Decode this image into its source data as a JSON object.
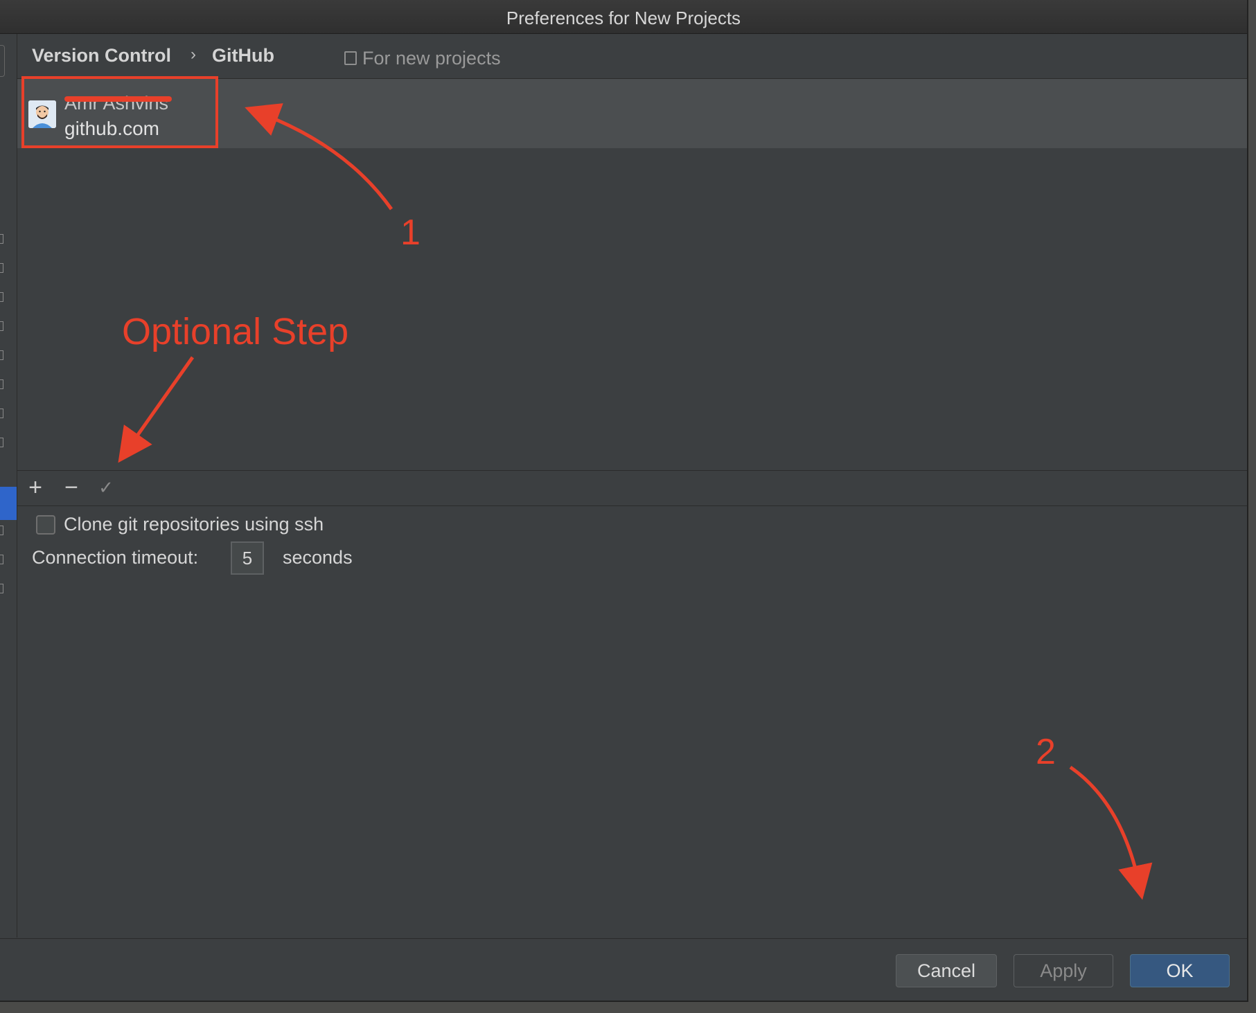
{
  "window": {
    "title": "Preferences for New Projects"
  },
  "header": {
    "breadcrumb": [
      "Version Control",
      "GitHub"
    ],
    "scope_label": "For new projects"
  },
  "accounts": [
    {
      "name": "Amr Ashvins",
      "host": "github.com"
    }
  ],
  "toolbar": {
    "add": "+",
    "remove": "−",
    "default": "✓"
  },
  "options": {
    "clone_ssh_label": "Clone git repositories using ssh",
    "clone_ssh_checked": false,
    "timeout_label": "Connection timeout:",
    "timeout_value": "5",
    "timeout_unit": "seconds"
  },
  "footer": {
    "cancel": "Cancel",
    "apply": "Apply",
    "ok": "OK"
  },
  "annotations": {
    "step1": "1",
    "optional": "Optional Step",
    "step2": "2",
    "color": "#e8402a"
  },
  "colors": {
    "background": "#3c3f41",
    "selection_row": "#4b4e50",
    "primary_button": "#365880",
    "sidebar_selected": "#2f65ca"
  }
}
